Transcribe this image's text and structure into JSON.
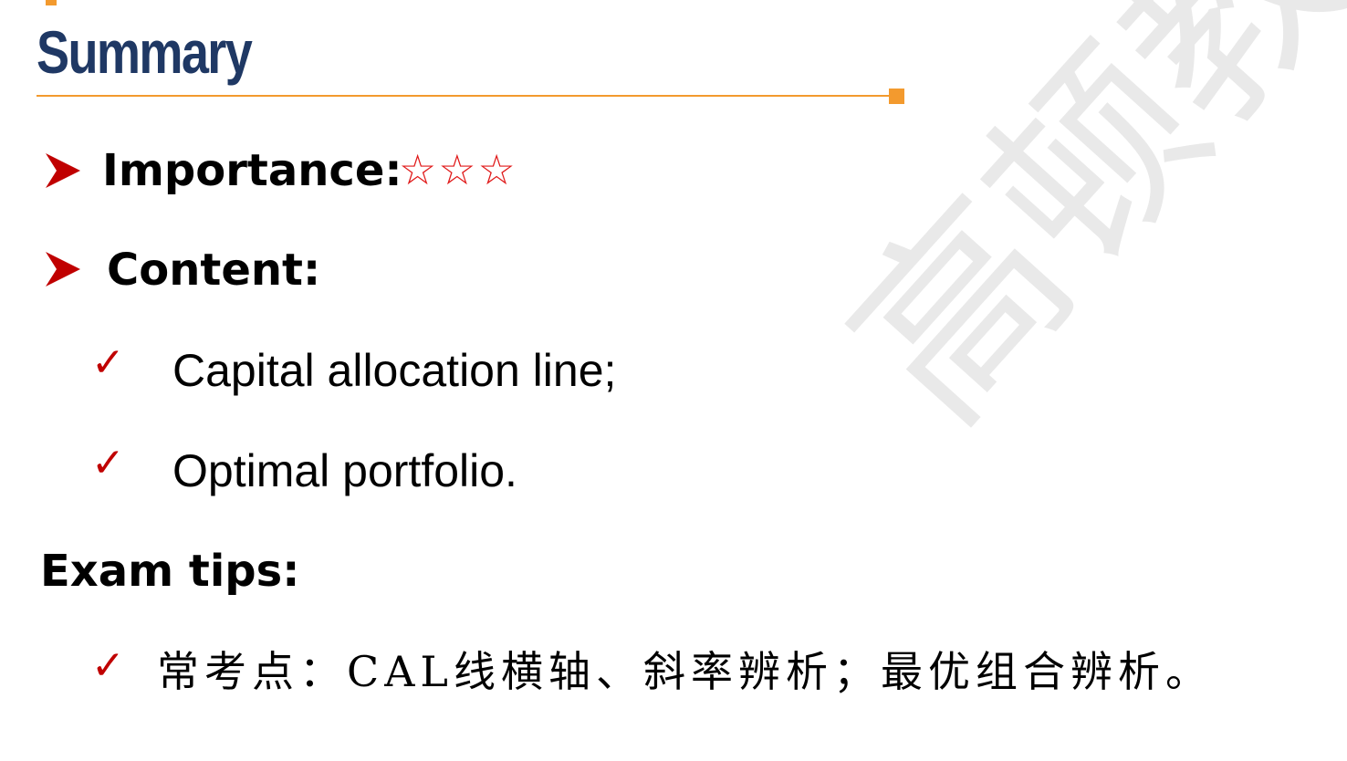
{
  "slide": {
    "title": "Summary",
    "watermark": "高顿教育",
    "importance": {
      "label": "Importance:",
      "stars": "☆☆☆",
      "rating": 3
    },
    "content": {
      "label": "Content:",
      "items": [
        "Capital allocation line;",
        "Optimal portfolio."
      ]
    },
    "exam_tips": {
      "label": "Exam tips:",
      "items": [
        "常考点：CAL线横轴、斜率辨析；最优组合辨析。"
      ]
    },
    "icons": {
      "bullet": "arrow-bullet-icon",
      "check": "checkmark-icon",
      "check_glyph": "✓"
    },
    "colors": {
      "title": "#1f3864",
      "accent": "#f39a2e",
      "bullet": "#c00000",
      "stars": "#e01a1a"
    }
  }
}
